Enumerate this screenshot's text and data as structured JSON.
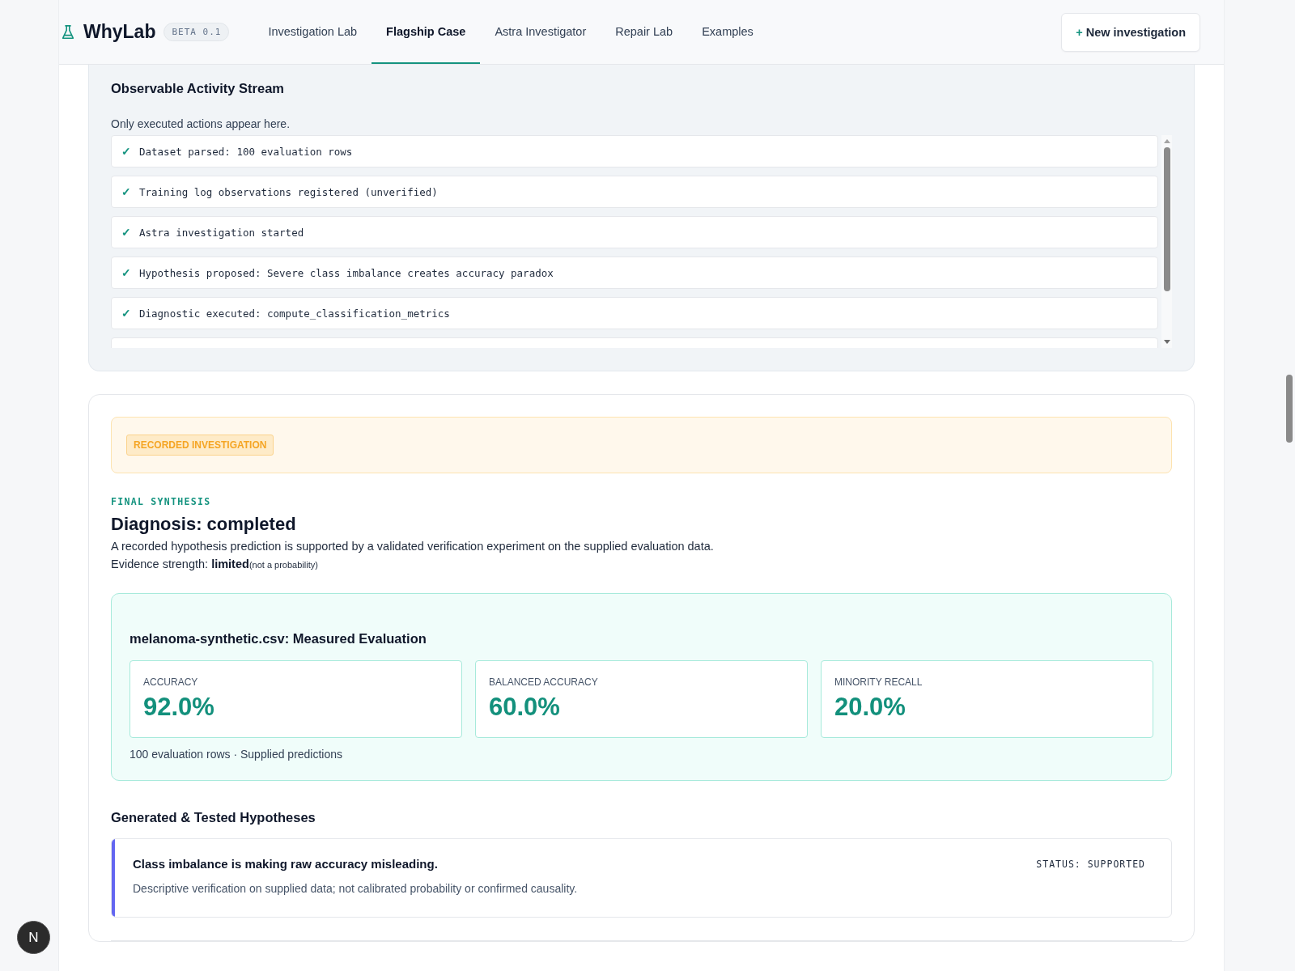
{
  "header": {
    "brand": "WhyLab",
    "badge": "BETA 0.1",
    "nav": [
      {
        "label": "Investigation Lab",
        "selected": false
      },
      {
        "label": "Flagship Case",
        "selected": true
      },
      {
        "label": "Astra Investigator",
        "selected": false
      },
      {
        "label": "Repair Lab",
        "selected": false
      },
      {
        "label": "Examples",
        "selected": false
      }
    ],
    "action": {
      "icon": "+",
      "label": "New investigation"
    }
  },
  "activity": {
    "title": "Observable Activity Stream",
    "subtitle": "Only executed actions appear here.",
    "items": [
      {
        "icon": "✓",
        "text": "Dataset parsed: 100 evaluation rows"
      },
      {
        "icon": "✓",
        "text": "Training log observations registered (unverified)"
      },
      {
        "icon": "✓",
        "text": "Astra investigation started"
      },
      {
        "icon": "✓",
        "text": "Hypothesis proposed: Severe class imbalance creates accuracy paradox"
      },
      {
        "icon": "✓",
        "text": "Diagnostic executed: compute_classification_metrics"
      }
    ]
  },
  "banner": {
    "badge": "RECORDED INVESTIGATION"
  },
  "synthesis": {
    "eyebrow": "FINAL SYNTHESIS",
    "title": "Diagnosis: completed",
    "summary": "A recorded hypothesis prediction is supported by a validated verification experiment on the supplied evaluation data.",
    "evidence": "Evidence strength: **limited**",
    "evidence_note": "(not a probability)"
  },
  "evaluation": {
    "title": "melanoma-synthetic.csv: Measured Evaluation",
    "metrics": [
      {
        "label": "ACCURACY",
        "value": "92.0%"
      },
      {
        "label": "BALANCED ACCURACY",
        "value": "60.0%"
      },
      {
        "label": "MINORITY RECALL",
        "value": "20.0%"
      }
    ],
    "footnote": "100 evaluation rows · Supplied predictions"
  },
  "hypotheses": {
    "title": "Generated & Tested Hypotheses",
    "items": [
      {
        "title": "Class imbalance is making raw accuracy misleading.",
        "status": "STATUS: SUPPORTED",
        "detail": "Descriptive verification on supplied data; not calibrated probability or confirmed causality.",
        "color": "#6366f1"
      }
    ]
  },
  "dev_badge": {
    "letter": "N"
  }
}
